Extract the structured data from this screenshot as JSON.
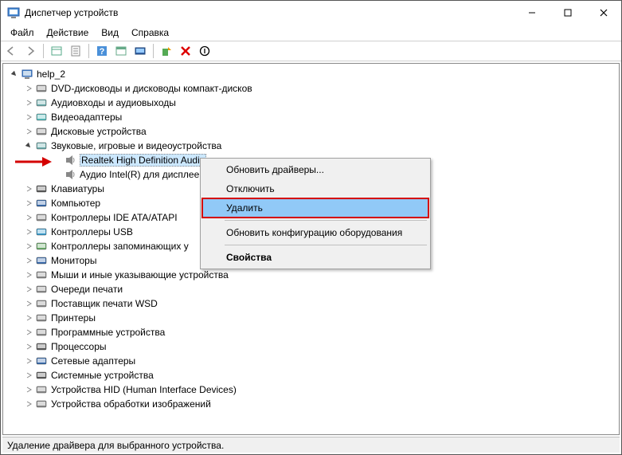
{
  "window": {
    "title": "Диспетчер устройств"
  },
  "menubar": {
    "file": "Файл",
    "action": "Действие",
    "view": "Вид",
    "help": "Справка"
  },
  "tree": {
    "root": "help_2",
    "items": [
      {
        "label": "DVD-дисководы и дисководы компакт-дисков",
        "iconColor": "#888"
      },
      {
        "label": "Аудиовходы и аудиовыходы",
        "iconColor": "#6aa"
      },
      {
        "label": "Видеоадаптеры",
        "iconColor": "#5bb"
      },
      {
        "label": "Дисковые устройства",
        "iconColor": "#888"
      },
      {
        "label": "Звуковые, игровые и видеоустройства",
        "iconColor": "#6aa",
        "expanded": true,
        "children": [
          {
            "label": "Realtek High Definition Audio",
            "selected": true
          },
          {
            "label": "Аудио Intel(R) для дисплеев"
          }
        ]
      },
      {
        "label": "Клавиатуры",
        "iconColor": "#555"
      },
      {
        "label": "Компьютер",
        "iconColor": "#36a"
      },
      {
        "label": "Контроллеры IDE ATA/ATAPI",
        "iconColor": "#888"
      },
      {
        "label": "Контроллеры USB",
        "iconColor": "#39c"
      },
      {
        "label": "Контроллеры запоминающих у",
        "iconColor": "#6a6"
      },
      {
        "label": "Мониторы",
        "iconColor": "#36a"
      },
      {
        "label": "Мыши и иные указывающие устройства",
        "iconColor": "#888"
      },
      {
        "label": "Очереди печати",
        "iconColor": "#888"
      },
      {
        "label": "Поставщик печати WSD",
        "iconColor": "#888"
      },
      {
        "label": "Принтеры",
        "iconColor": "#888"
      },
      {
        "label": "Программные устройства",
        "iconColor": "#888"
      },
      {
        "label": "Процессоры",
        "iconColor": "#555"
      },
      {
        "label": "Сетевые адаптеры",
        "iconColor": "#36a"
      },
      {
        "label": "Системные устройства",
        "iconColor": "#555"
      },
      {
        "label": "Устройства HID (Human Interface Devices)",
        "iconColor": "#888"
      },
      {
        "label": "Устройства обработки изображений",
        "iconColor": "#888"
      }
    ]
  },
  "context_menu": {
    "update_drivers": "Обновить драйверы...",
    "disable": "Отключить",
    "delete": "Удалить",
    "scan_hardware": "Обновить конфигурацию оборудования",
    "properties": "Свойства"
  },
  "statusbar": {
    "text": "Удаление драйвера для выбранного устройства."
  }
}
